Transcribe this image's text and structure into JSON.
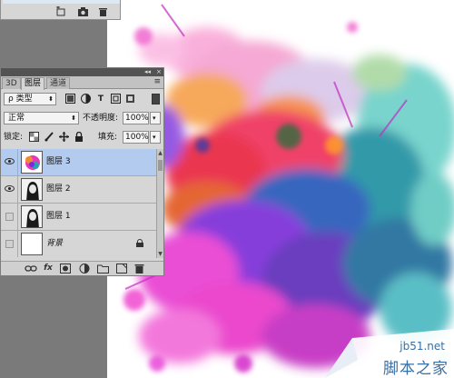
{
  "tabs": [
    {
      "label": "3D"
    },
    {
      "label": "图层"
    },
    {
      "label": "通道"
    }
  ],
  "panel": {
    "collapse_glyph": "◂◂",
    "close_glyph": "×",
    "menu_glyph": "≡"
  },
  "filter": {
    "kind_value": "ρ 类型",
    "icon_names": [
      "image-filter-icon",
      "adjustment-filter-icon",
      "type-filter-icon",
      "shape-filter-icon",
      "smart-object-filter-icon"
    ]
  },
  "blend": {
    "mode_value": "正常",
    "opacity_label": "不透明度:",
    "opacity_value": "100%"
  },
  "lock": {
    "label": "锁定:",
    "fill_label": "填充:",
    "fill_value": "100%"
  },
  "layers": [
    {
      "name": "图层 3",
      "visible": true,
      "selected": true,
      "thumb": "color-splash"
    },
    {
      "name": "图层 2",
      "visible": true,
      "selected": false,
      "thumb": "portrait"
    },
    {
      "name": "图层 1",
      "visible": false,
      "selected": false,
      "thumb": "portrait"
    },
    {
      "name": "背景",
      "visible": false,
      "selected": false,
      "thumb": "white",
      "locked": true
    }
  ],
  "bottom_icons": [
    "link-icon",
    "fx-icon",
    "mask-icon",
    "adjustment-layer-icon",
    "group-folder-icon",
    "new-layer-icon",
    "trash-icon"
  ],
  "bottom_labels": {
    "fx": "fx"
  },
  "watermark": {
    "site": "jb51.net",
    "name": "脚本之家"
  }
}
